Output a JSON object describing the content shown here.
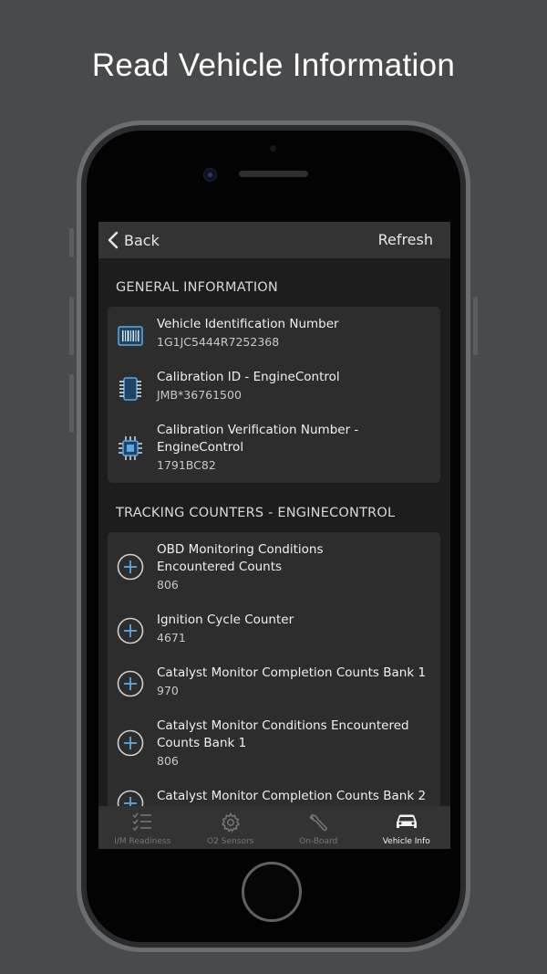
{
  "headline": "Read Vehicle Information",
  "nav": {
    "back_label": "Back",
    "refresh_label": "Refresh"
  },
  "sections": {
    "general": {
      "header": "GENERAL INFORMATION",
      "items": [
        {
          "icon": "barcode-icon",
          "title": "Vehicle Identification Number",
          "value": "1G1JC5444R7252368"
        },
        {
          "icon": "chip-icon",
          "title": "Calibration ID - EngineControl",
          "value": "JMB*36761500"
        },
        {
          "icon": "processor-icon",
          "title_line1": "Calibration Verification Number -",
          "title_line2": "EngineControl",
          "value": "1791BC82"
        }
      ]
    },
    "tracking": {
      "header": "TRACKING COUNTERS - ENGINECONTROL",
      "items": [
        {
          "icon": "plus-circle-icon",
          "title_line1": "OBD Monitoring Conditions",
          "title_line2": "Encountered Counts",
          "value": "806"
        },
        {
          "icon": "plus-circle-icon",
          "title": "Ignition Cycle Counter",
          "value": "4671"
        },
        {
          "icon": "plus-circle-icon",
          "title": "Catalyst Monitor Completion Counts Bank 1",
          "value": "970"
        },
        {
          "icon": "plus-circle-icon",
          "title_line1": "Catalyst Monitor Conditions Encountered",
          "title_line2": "Counts Bank 1",
          "value": "806"
        },
        {
          "icon": "plus-circle-icon",
          "title": "Catalyst Monitor Completion Counts Bank 2"
        }
      ]
    }
  },
  "tabs": [
    {
      "label": "I/M Readiness",
      "icon": "checklist-icon",
      "active": false
    },
    {
      "label": "O2 Sensors",
      "icon": "gear-icon",
      "active": false
    },
    {
      "label": "On-Board",
      "icon": "wrench-icon",
      "active": false
    },
    {
      "label": "Vehicle Info",
      "icon": "car-icon",
      "active": true
    }
  ],
  "colors": {
    "background": "#484a4c",
    "screen": "#1d1d1d",
    "card": "#2d2d2d",
    "accent_icon": "#5aa8e6"
  }
}
